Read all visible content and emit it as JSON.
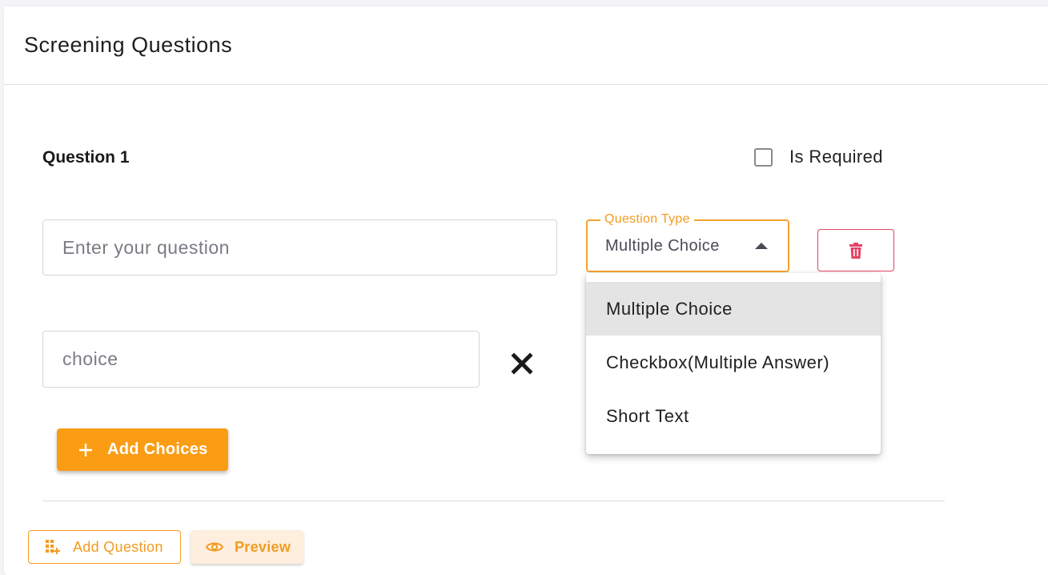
{
  "card": {
    "title": "Screening Questions"
  },
  "question": {
    "label": "Question 1",
    "is_required_label": "Is Required",
    "is_required_checked": false,
    "input_placeholder": "Enter your question",
    "type_select": {
      "legend": "Question Type",
      "value": "Multiple Choice",
      "caret_icon": "caret-up-icon"
    },
    "delete_icon": "trash-icon",
    "choices": [
      {
        "placeholder": "choice",
        "remove_icon": "close-icon"
      }
    ],
    "add_choices_label": "Add Choices",
    "add_choices_icon": "plus-icon"
  },
  "type_menu": {
    "options": [
      "Multiple Choice",
      "Checkbox(Multiple Answer)",
      "Short Text"
    ],
    "selected": "Multiple Choice"
  },
  "footer": {
    "add_question_label": "Add Question",
    "add_question_icon": "add-grid-icon",
    "preview_label": "Preview",
    "preview_icon": "eye-icon"
  },
  "colors": {
    "accent": "#fa9d15",
    "accent_text": "#f29b20",
    "danger": "#e24464",
    "preview_bg": "#fdeedd",
    "menu_selected_bg": "#e4e4e4"
  }
}
